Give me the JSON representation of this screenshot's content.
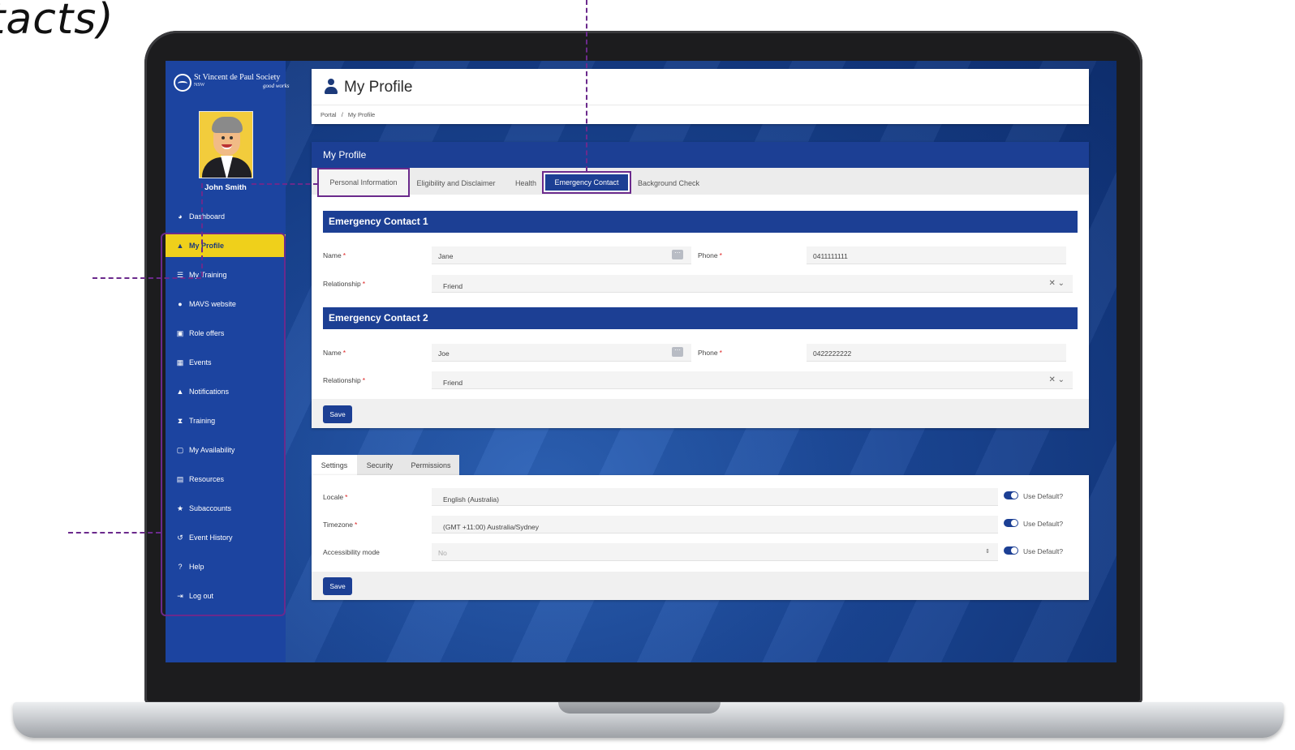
{
  "caption": "tacts)",
  "brand": {
    "name": "St Vincent de Paul Society",
    "sub": "NSW",
    "tagline": "good works"
  },
  "user": {
    "name": "John Smith"
  },
  "sidebar": {
    "items": [
      {
        "label": "Dashboard",
        "icon": "dashboard-icon",
        "glyph": "◕"
      },
      {
        "label": "My Profile",
        "icon": "user-icon",
        "glyph": "▲",
        "active": true
      },
      {
        "label": "My Training",
        "icon": "training-icon",
        "glyph": "☰"
      },
      {
        "label": "MAVS website",
        "icon": "globe-icon",
        "glyph": "●"
      },
      {
        "label": "Role offers",
        "icon": "briefcase-icon",
        "glyph": "▣"
      },
      {
        "label": "Events",
        "icon": "calendar-icon",
        "glyph": "▦"
      },
      {
        "label": "Notifications",
        "icon": "bell-icon",
        "glyph": "▲"
      },
      {
        "label": "Training",
        "icon": "hourglass-icon",
        "glyph": "⧗"
      },
      {
        "label": "My Availability",
        "icon": "calendar-check-icon",
        "glyph": "▢"
      },
      {
        "label": "Resources",
        "icon": "folder-icon",
        "glyph": "▤"
      },
      {
        "label": "Subaccounts",
        "icon": "star-icon",
        "glyph": "★"
      },
      {
        "label": "Event History",
        "icon": "history-icon",
        "glyph": "↺"
      },
      {
        "label": "Help",
        "icon": "help-icon",
        "glyph": "?"
      },
      {
        "label": "Log out",
        "icon": "logout-icon",
        "glyph": "⇥"
      }
    ]
  },
  "header": {
    "title": "My Profile",
    "breadcrumb": [
      "Portal",
      "/",
      "My Profile"
    ]
  },
  "profile": {
    "card_title": "My Profile",
    "tabs": [
      "Personal Information",
      "Eligibility and Disclaimer",
      "Health",
      "Emergency Contact",
      "Background Check"
    ],
    "active_tab": "Emergency Contact",
    "contact1": {
      "title": "Emergency Contact 1",
      "name_label": "Name",
      "name_value": "Jane",
      "phone_label": "Phone",
      "phone_value": "0411111111",
      "relationship_label": "Relationship",
      "relationship_value": "Friend"
    },
    "contact2": {
      "title": "Emergency Contact 2",
      "name_label": "Name",
      "name_value": "Joe",
      "phone_label": "Phone",
      "phone_value": "0422222222",
      "relationship_label": "Relationship",
      "relationship_value": "Friend"
    },
    "required_mark": "*",
    "save_label": "Save"
  },
  "settings": {
    "tabs": [
      "Settings",
      "Security",
      "Permissions"
    ],
    "active_tab": "Settings",
    "locale_label": "Locale",
    "locale_value": "English (Australia)",
    "timezone_label": "Timezone",
    "timezone_value": "(GMT +11:00) Australia/Sydney",
    "accessibility_label": "Accessibility mode",
    "accessibility_value": "No",
    "use_default_label": "Use Default?",
    "save_label": "Save"
  },
  "colors": {
    "primary": "#1c3f94",
    "sidebar": "#1c44a0",
    "active_nav": "#efd01b",
    "annotation": "#6b2a8c"
  }
}
